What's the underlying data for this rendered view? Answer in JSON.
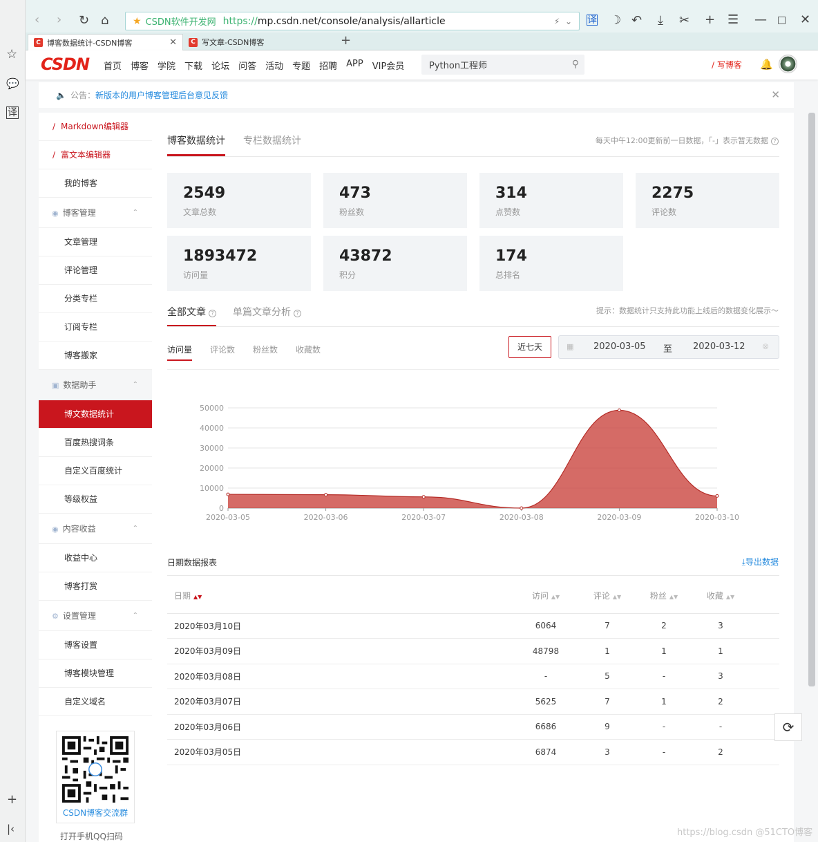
{
  "browser": {
    "site_name": "CSDN软件开发网",
    "url_scheme": "https://",
    "url_rest": "mp.csdn.net/console/analysis/allarticle",
    "tabs": [
      {
        "label": "博客数据统计-CSDN博客"
      },
      {
        "label": "写文章-CSDN博客"
      }
    ],
    "favicon_letter": "C"
  },
  "header": {
    "logo": "CSDN",
    "nav": [
      "首页",
      "博客",
      "学院",
      "下载",
      "论坛",
      "问答",
      "活动",
      "专题",
      "招聘",
      "APP",
      "VIP会员"
    ],
    "search_value": "Python工程师",
    "write_label": "写博客"
  },
  "notice": {
    "prefix": "公告：",
    "link": "新版本的用户博客管理后台意见反馈"
  },
  "sidebar": {
    "editors": [
      "Markdown编辑器",
      "富文本编辑器"
    ],
    "my_blog": "我的博客",
    "groups": [
      {
        "title": "博客管理",
        "items": [
          "文章管理",
          "评论管理",
          "分类专栏",
          "订阅专栏",
          "博客搬家"
        ]
      },
      {
        "title": "数据助手",
        "items": [
          "博文数据统计",
          "百度热搜词条",
          "自定义百度统计",
          "等级权益"
        ]
      },
      {
        "title": "内容收益",
        "items": [
          "收益中心",
          "博客打赏"
        ]
      },
      {
        "title": "设置管理",
        "items": [
          "博客设置",
          "博客模块管理",
          "自定义域名"
        ]
      }
    ],
    "qr_caption": "CSDN博客交流群",
    "qr_hint": "打开手机QQ扫码"
  },
  "main": {
    "tabs": [
      "博客数据统计",
      "专栏数据统计"
    ],
    "update_hint": "每天中午12:00更新前一日数据，「-」表示暂无数据",
    "stats": [
      {
        "value": "2549",
        "label": "文章总数"
      },
      {
        "value": "473",
        "label": "粉丝数"
      },
      {
        "value": "314",
        "label": "点赞数"
      },
      {
        "value": "2275",
        "label": "评论数"
      },
      {
        "value": "1893472",
        "label": "访问量"
      },
      {
        "value": "43872",
        "label": "积分"
      },
      {
        "value": "174",
        "label": "总排名"
      }
    ],
    "section_tabs": [
      "全部文章",
      "单篇文章分析"
    ],
    "section_hint": "提示：数据统计只支持此功能上线后的数据变化展示～",
    "metric_tabs": [
      "访问量",
      "评论数",
      "粉丝数",
      "收藏数"
    ],
    "week_button": "近七天",
    "date_from": "2020-03-05",
    "date_sep": "至",
    "date_to": "2020-03-12",
    "report_title": "日期数据报表",
    "export_label": "导出数据",
    "table": {
      "headers": [
        "日期",
        "访问",
        "评论",
        "粉丝",
        "收藏"
      ],
      "rows": [
        [
          "2020年03月10日",
          "6064",
          "7",
          "2",
          "3"
        ],
        [
          "2020年03月09日",
          "48798",
          "1",
          "1",
          "1"
        ],
        [
          "2020年03月08日",
          "-",
          "5",
          "-",
          "3"
        ],
        [
          "2020年03月07日",
          "5625",
          "7",
          "1",
          "2"
        ],
        [
          "2020年03月06日",
          "6686",
          "9",
          "-",
          "-"
        ],
        [
          "2020年03月05日",
          "6874",
          "3",
          "-",
          "2"
        ]
      ]
    }
  },
  "chart_data": {
    "type": "area",
    "x": [
      "2020-03-05",
      "2020-03-06",
      "2020-03-07",
      "2020-03-08",
      "2020-03-09",
      "2020-03-10"
    ],
    "series": [
      {
        "values": [
          6874,
          6686,
          5625,
          0,
          48798,
          6064
        ],
        "color": "#c9413b"
      }
    ],
    "ylim": [
      0,
      50000
    ],
    "yticks": [
      0,
      10000,
      20000,
      30000,
      40000,
      50000
    ],
    "grid": true
  },
  "watermark": "https://blog.csdn @51CTO博客"
}
